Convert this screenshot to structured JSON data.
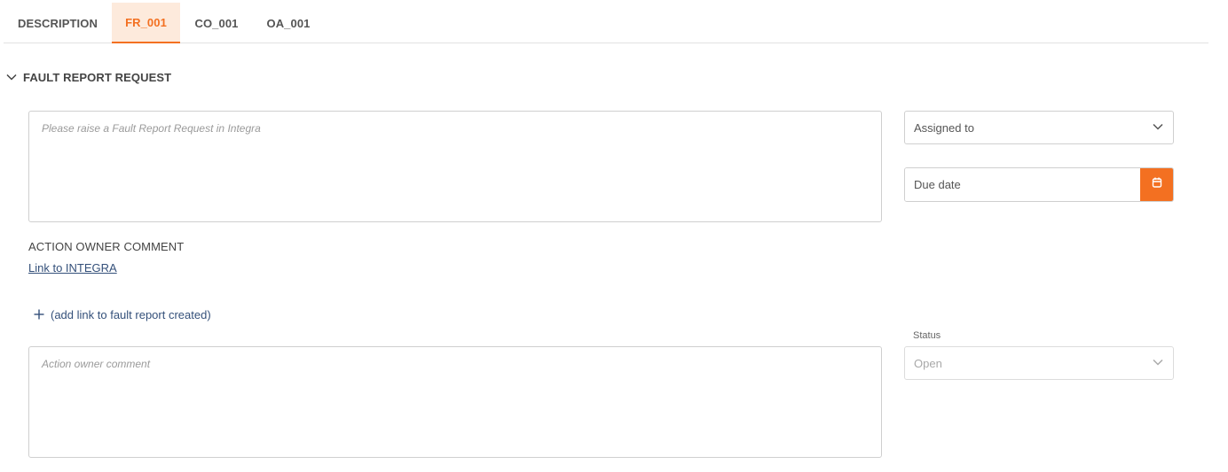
{
  "tabs": [
    {
      "label": "DESCRIPTION",
      "active": false
    },
    {
      "label": "FR_001",
      "active": true
    },
    {
      "label": "CO_001",
      "active": false
    },
    {
      "label": "OA_001",
      "active": false
    }
  ],
  "section": {
    "title": "FAULT REPORT REQUEST",
    "icon": "chevron-down-icon"
  },
  "fault_request": {
    "placeholder": "Please raise a Fault Report Request in Integra",
    "value": ""
  },
  "assigned_to": {
    "placeholder": "Assigned to"
  },
  "due_date": {
    "placeholder": "Due date",
    "icon": "calendar-icon"
  },
  "action_owner": {
    "label": "ACTION OWNER COMMENT",
    "link_label": "Link to INTEGRA",
    "add_link_label": "(add link to fault report created)",
    "comment_placeholder": "Action owner comment"
  },
  "status": {
    "label": "Status",
    "value": "Open"
  },
  "colors": {
    "accent": "#f37021",
    "accent_bg": "#fdeadc",
    "link": "#34507a"
  }
}
